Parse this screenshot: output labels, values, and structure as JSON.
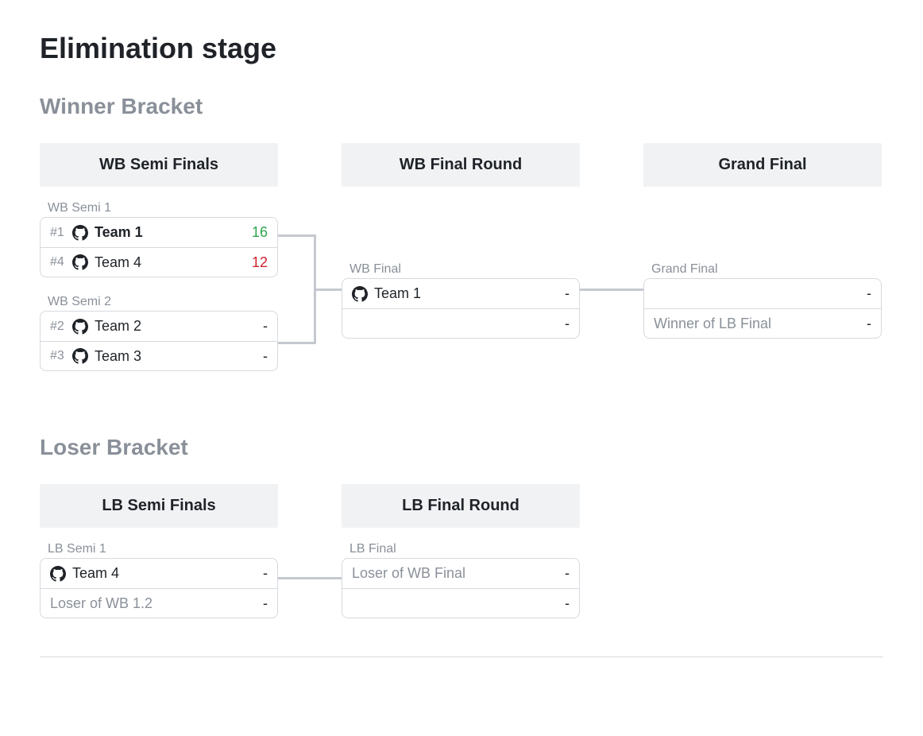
{
  "title": "Elimination stage",
  "winner_bracket": {
    "heading": "Winner Bracket",
    "rounds": [
      "WB Semi Finals",
      "WB Final Round",
      "Grand Final"
    ],
    "semi1": {
      "title": "WB Semi 1",
      "p1": {
        "seed": "#1",
        "name": "Team 1",
        "score": "16"
      },
      "p2": {
        "seed": "#4",
        "name": "Team 4",
        "score": "12"
      }
    },
    "semi2": {
      "title": "WB Semi 2",
      "p1": {
        "seed": "#2",
        "name": "Team 2",
        "score": "-"
      },
      "p2": {
        "seed": "#3",
        "name": "Team 3",
        "score": "-"
      }
    },
    "final": {
      "title": "WB Final",
      "p1": {
        "name": "Team 1",
        "score": "-"
      },
      "p2": {
        "name": "",
        "score": "-"
      }
    },
    "grand": {
      "title": "Grand Final",
      "p1": {
        "name": "",
        "score": "-"
      },
      "p2": {
        "name": "Winner of LB Final",
        "score": "-"
      }
    }
  },
  "loser_bracket": {
    "heading": "Loser Bracket",
    "rounds": [
      "LB Semi Finals",
      "LB Final Round"
    ],
    "semi1": {
      "title": "LB Semi 1",
      "p1": {
        "name": "Team 4",
        "score": "-"
      },
      "p2": {
        "name": "Loser of WB 1.2",
        "score": "-"
      }
    },
    "final": {
      "title": "LB Final",
      "p1": {
        "name": "Loser of WB Final",
        "score": "-"
      },
      "p2": {
        "name": "",
        "score": "-"
      }
    }
  }
}
